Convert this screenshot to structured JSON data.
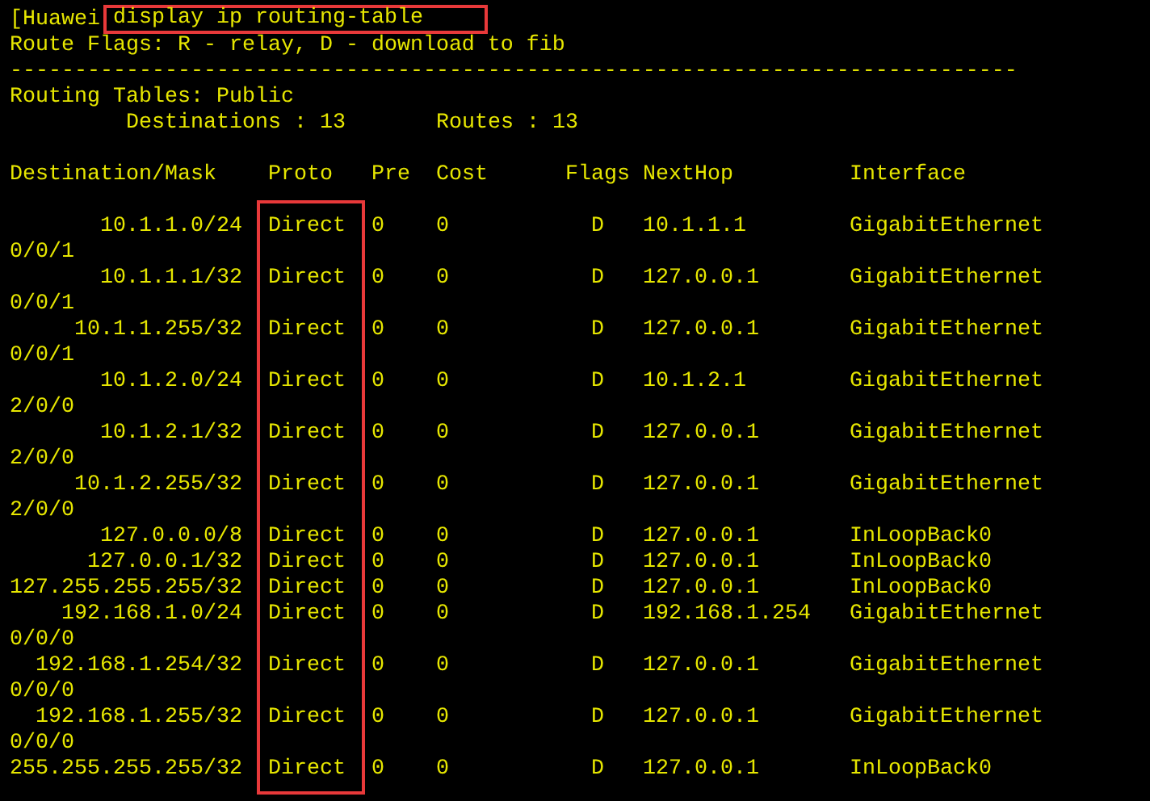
{
  "terminal": {
    "prompt": "[Huawei",
    "command": "display ip routing-table",
    "route_flags": "Route Flags: R - relay, D - download to fib",
    "separator": "------------------------------------------------------------------------------",
    "routing_tables": "Routing Tables: Public",
    "destinations": "Destinations : 13",
    "routes": "Routes : 13",
    "columns": [
      "Destination/Mask",
      "Proto",
      "Pre",
      "Cost",
      "Flags",
      "NextHop",
      "Interface"
    ],
    "rows": [
      {
        "destination": "10.1.1.0/24",
        "proto": "Direct",
        "pre": "0",
        "cost": "0",
        "flags": "D",
        "nexthop": "10.1.1.1",
        "interface": "GigabitEthernet",
        "interface_wrapped": "0/0/1"
      },
      {
        "destination": "10.1.1.1/32",
        "proto": "Direct",
        "pre": "0",
        "cost": "0",
        "flags": "D",
        "nexthop": "127.0.0.1",
        "interface": "GigabitEthernet",
        "interface_wrapped": "0/0/1"
      },
      {
        "destination": "10.1.1.255/32",
        "proto": "Direct",
        "pre": "0",
        "cost": "0",
        "flags": "D",
        "nexthop": "127.0.0.1",
        "interface": "GigabitEthernet",
        "interface_wrapped": "0/0/1"
      },
      {
        "destination": "10.1.2.0/24",
        "proto": "Direct",
        "pre": "0",
        "cost": "0",
        "flags": "D",
        "nexthop": "10.1.2.1",
        "interface": "GigabitEthernet",
        "interface_wrapped": "2/0/0"
      },
      {
        "destination": "10.1.2.1/32",
        "proto": "Direct",
        "pre": "0",
        "cost": "0",
        "flags": "D",
        "nexthop": "127.0.0.1",
        "interface": "GigabitEthernet",
        "interface_wrapped": "2/0/0"
      },
      {
        "destination": "10.1.2.255/32",
        "proto": "Direct",
        "pre": "0",
        "cost": "0",
        "flags": "D",
        "nexthop": "127.0.0.1",
        "interface": "GigabitEthernet",
        "interface_wrapped": "2/0/0"
      },
      {
        "destination": "127.0.0.0/8",
        "proto": "Direct",
        "pre": "0",
        "cost": "0",
        "flags": "D",
        "nexthop": "127.0.0.1",
        "interface": "InLoopBack0"
      },
      {
        "destination": "127.0.0.1/32",
        "proto": "Direct",
        "pre": "0",
        "cost": "0",
        "flags": "D",
        "nexthop": "127.0.0.1",
        "interface": "InLoopBack0"
      },
      {
        "destination": "127.255.255.255/32",
        "proto": "Direct",
        "pre": "0",
        "cost": "0",
        "flags": "D",
        "nexthop": "127.0.0.1",
        "interface": "InLoopBack0"
      },
      {
        "destination": "192.168.1.0/24",
        "proto": "Direct",
        "pre": "0",
        "cost": "0",
        "flags": "D",
        "nexthop": "192.168.1.254",
        "interface": "GigabitEthernet",
        "interface_wrapped": "0/0/0"
      },
      {
        "destination": "192.168.1.254/32",
        "proto": "Direct",
        "pre": "0",
        "cost": "0",
        "flags": "D",
        "nexthop": "127.0.0.1",
        "interface": "GigabitEthernet",
        "interface_wrapped": "0/0/0"
      },
      {
        "destination": "192.168.1.255/32",
        "proto": "Direct",
        "pre": "0",
        "cost": "0",
        "flags": "D",
        "nexthop": "127.0.0.1",
        "interface": "GigabitEthernet",
        "interface_wrapped": "0/0/0"
      },
      {
        "destination": "255.255.255.255/32",
        "proto": "Direct",
        "pre": "0",
        "cost": "0",
        "flags": "D",
        "nexthop": "127.0.0.1",
        "interface": "InLoopBack0"
      }
    ]
  }
}
